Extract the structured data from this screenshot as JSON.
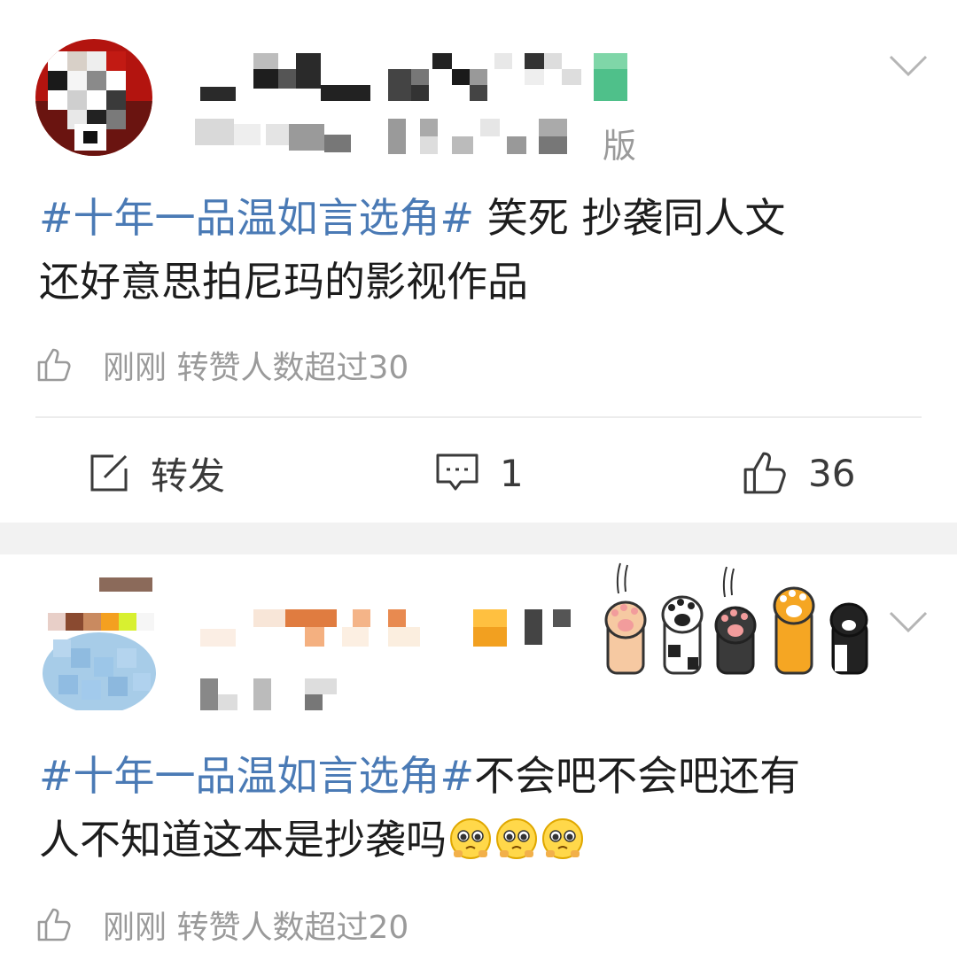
{
  "posts": [
    {
      "source_suffix": "版",
      "hashtag": "#十年一品温如言选角#",
      "text_line1": " 笑死 抄袭同人文",
      "text_line2": "还好意思拍尼玛的影视作品",
      "like_text": "刚刚 转赞人数超过30",
      "actions": {
        "repost_label": "转发",
        "comment_count": "1",
        "like_count": "36"
      }
    },
    {
      "hashtag": "#十年一品温如言选角#",
      "text_line1": "不会吧不会吧还有",
      "text_line2": "人不知道这本是抄袭吗",
      "emoji_name": "pleading-face-icon",
      "emoji_count": 3,
      "like_text": "刚刚 转赞人数超过20"
    }
  ],
  "colors": {
    "hashtag": "#4a7ab5",
    "secondary": "#9a9a9a",
    "separator": "#f2f2f2"
  }
}
